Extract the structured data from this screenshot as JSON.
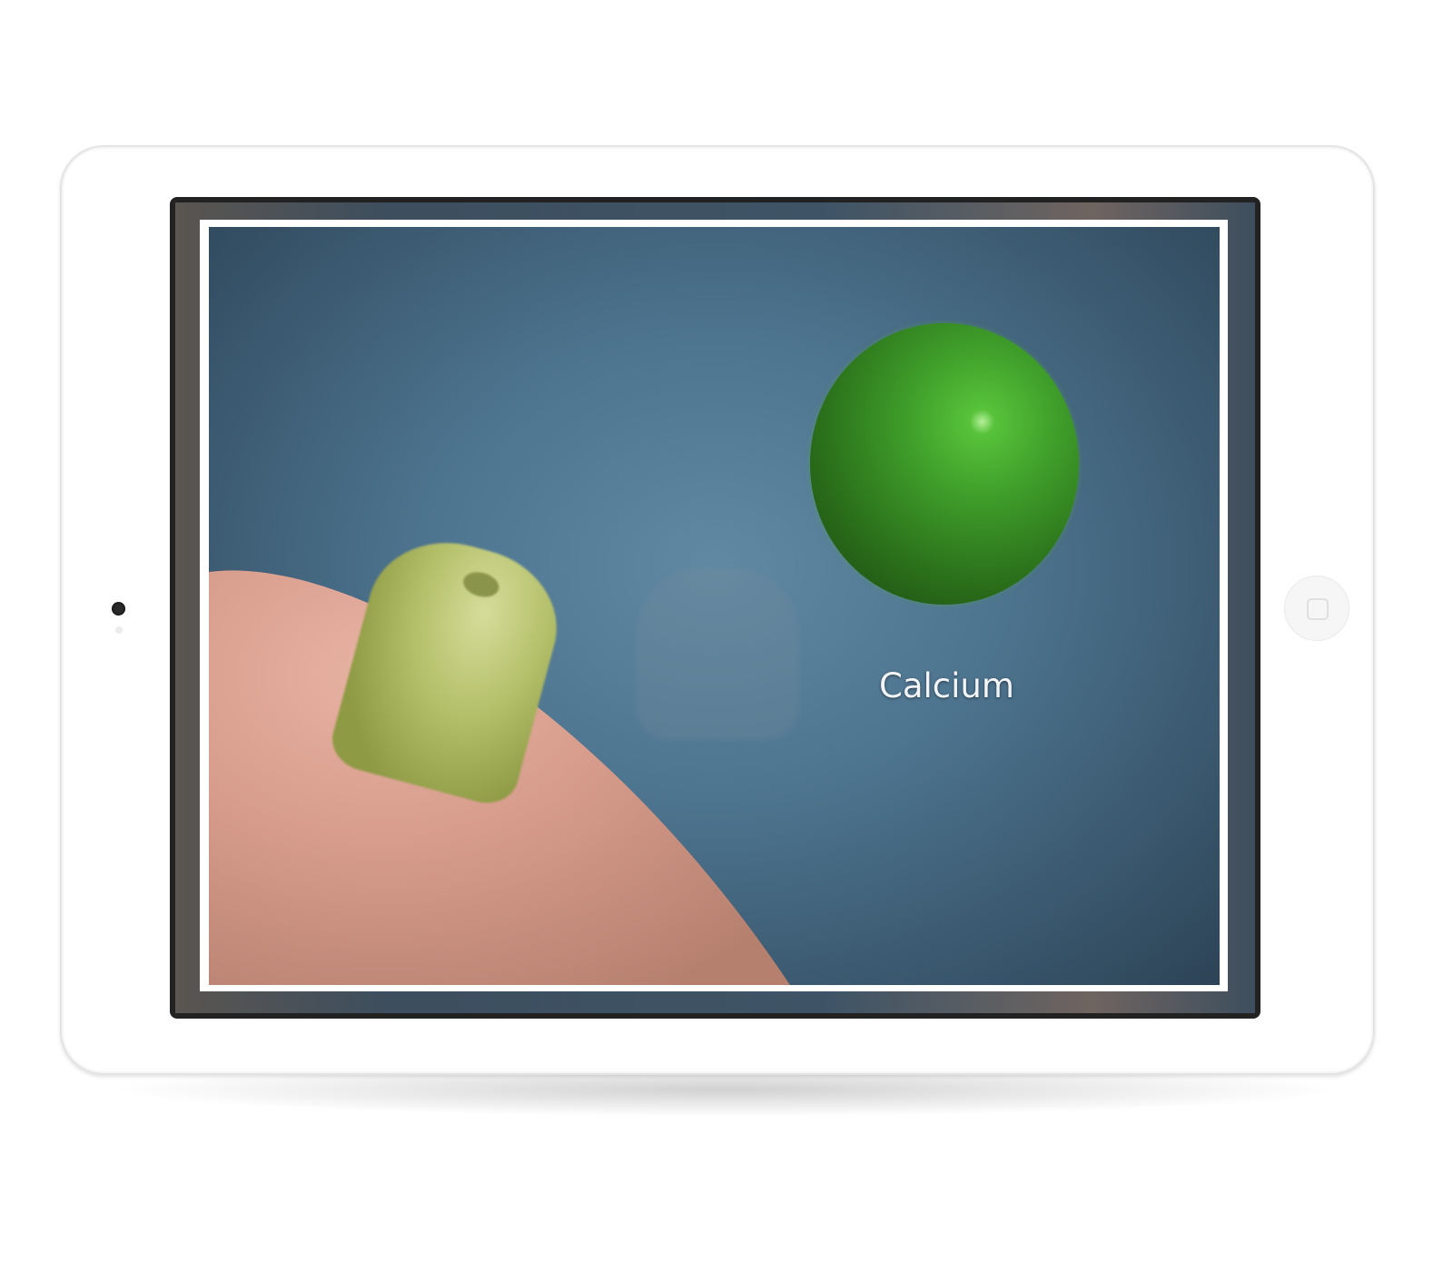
{
  "scene": {
    "label": "Calcium"
  },
  "device": {
    "camera_icon": "camera-icon",
    "home_icon": "home-button-icon"
  },
  "colors": {
    "sphere": "#3f9e2a",
    "background": "#4e7590",
    "tablet_body": "#ffffff"
  }
}
